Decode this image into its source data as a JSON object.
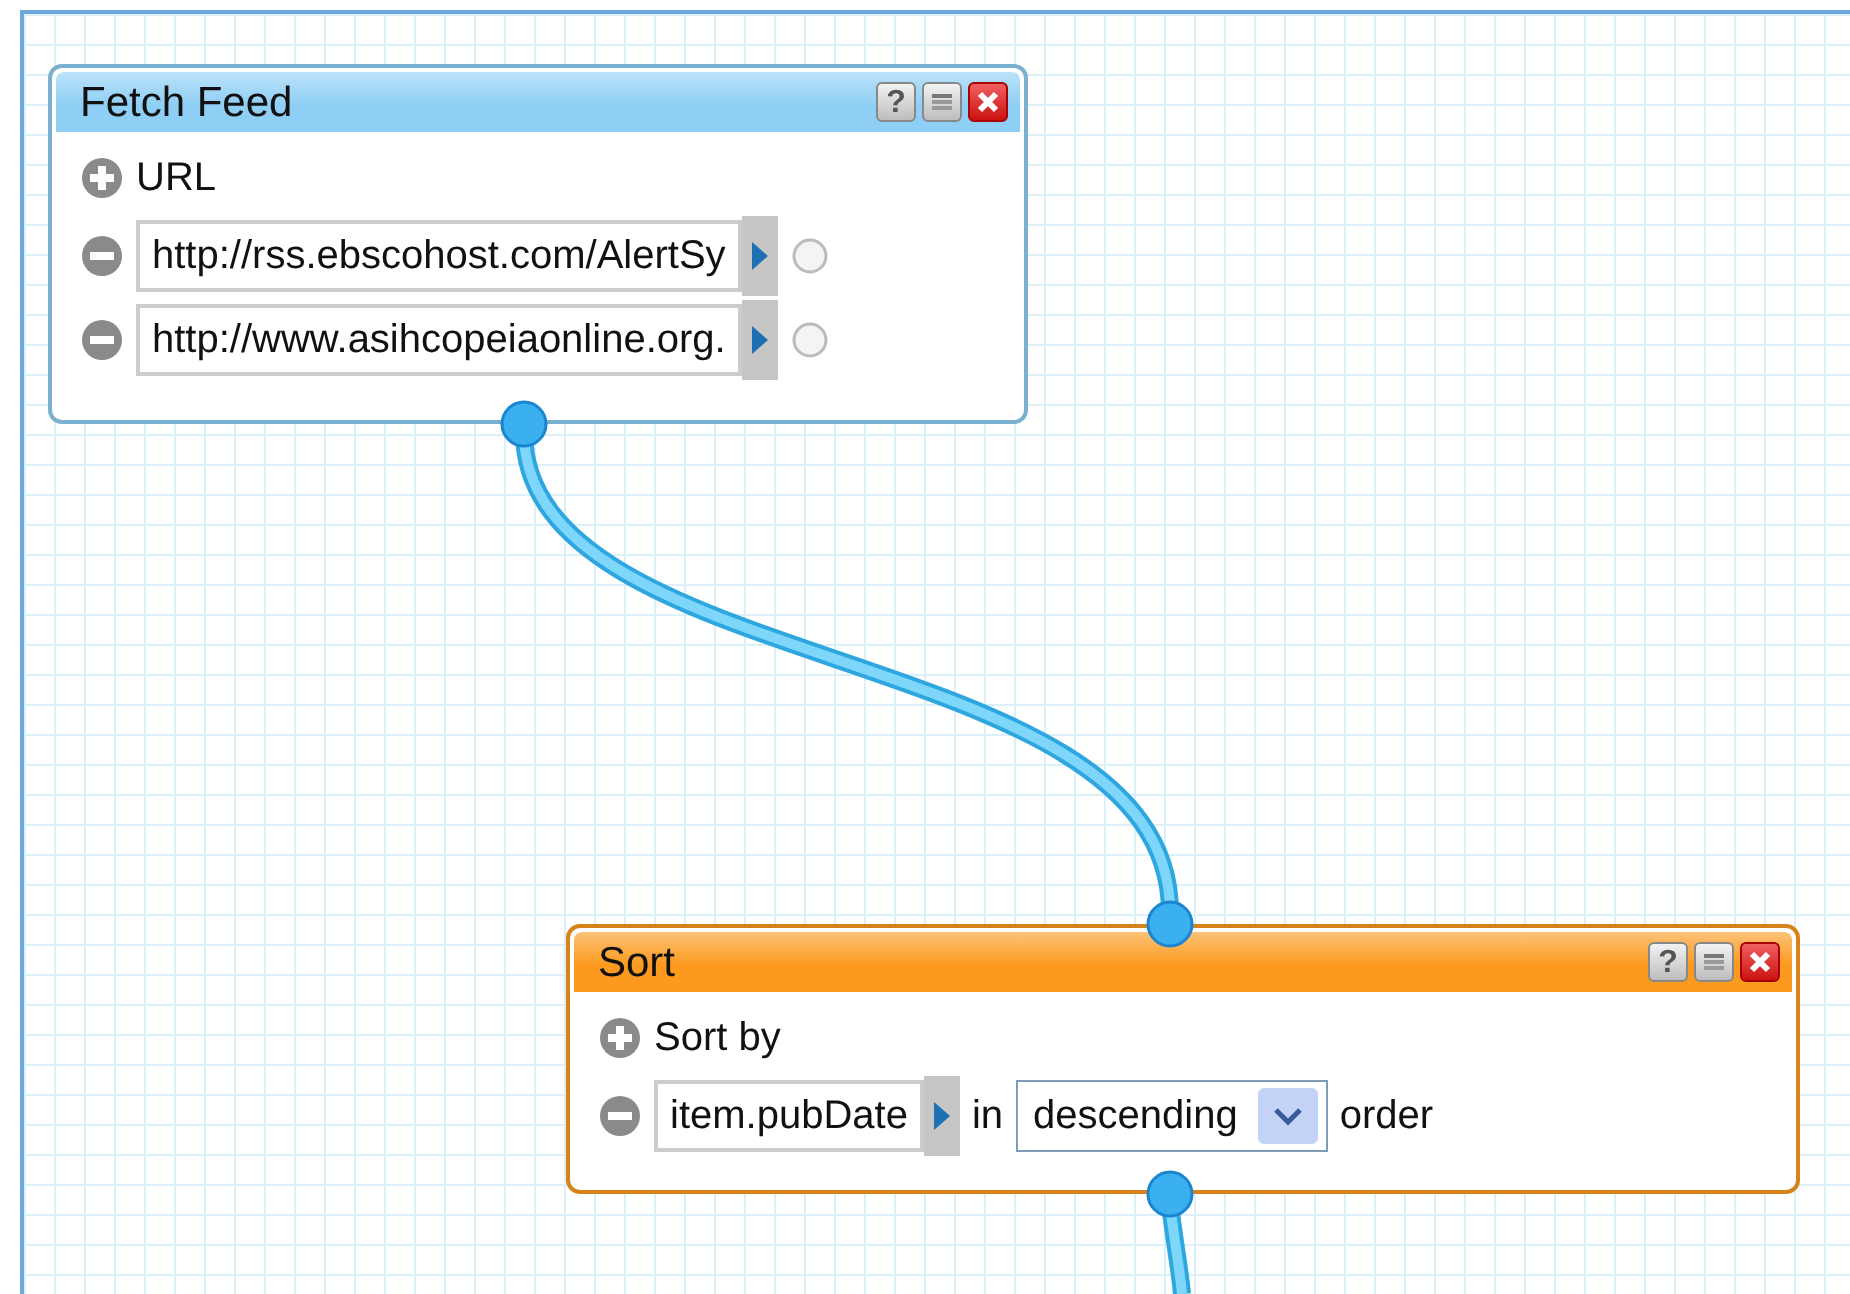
{
  "modules": [
    {
      "title": "Fetch Feed",
      "color": "#8fcff5",
      "header_buttons": [
        {
          "kind": "help",
          "glyph": "?"
        },
        {
          "kind": "minimize"
        },
        {
          "kind": "close"
        }
      ],
      "add_label": "URL",
      "rows": [
        {
          "value": "http://rss.ebscohost.com/AlertSy",
          "has_terminal": true,
          "parts": []
        },
        {
          "value": "http://www.asihcopeiaonline.org.",
          "has_terminal": true,
          "parts": []
        }
      ]
    },
    {
      "title": "Sort",
      "color": "#fb9a1e",
      "header_buttons": [
        {
          "kind": "help",
          "glyph": "?"
        },
        {
          "kind": "minimize"
        },
        {
          "kind": "close"
        }
      ],
      "add_label": "Sort by",
      "rows": [
        {
          "value": "item.pubDate",
          "has_terminal": false,
          "parts": [
            {
              "kind": "text",
              "text": "in"
            },
            {
              "kind": "select",
              "value": "descending"
            },
            {
              "kind": "text",
              "text": "order"
            }
          ]
        }
      ]
    }
  ]
}
